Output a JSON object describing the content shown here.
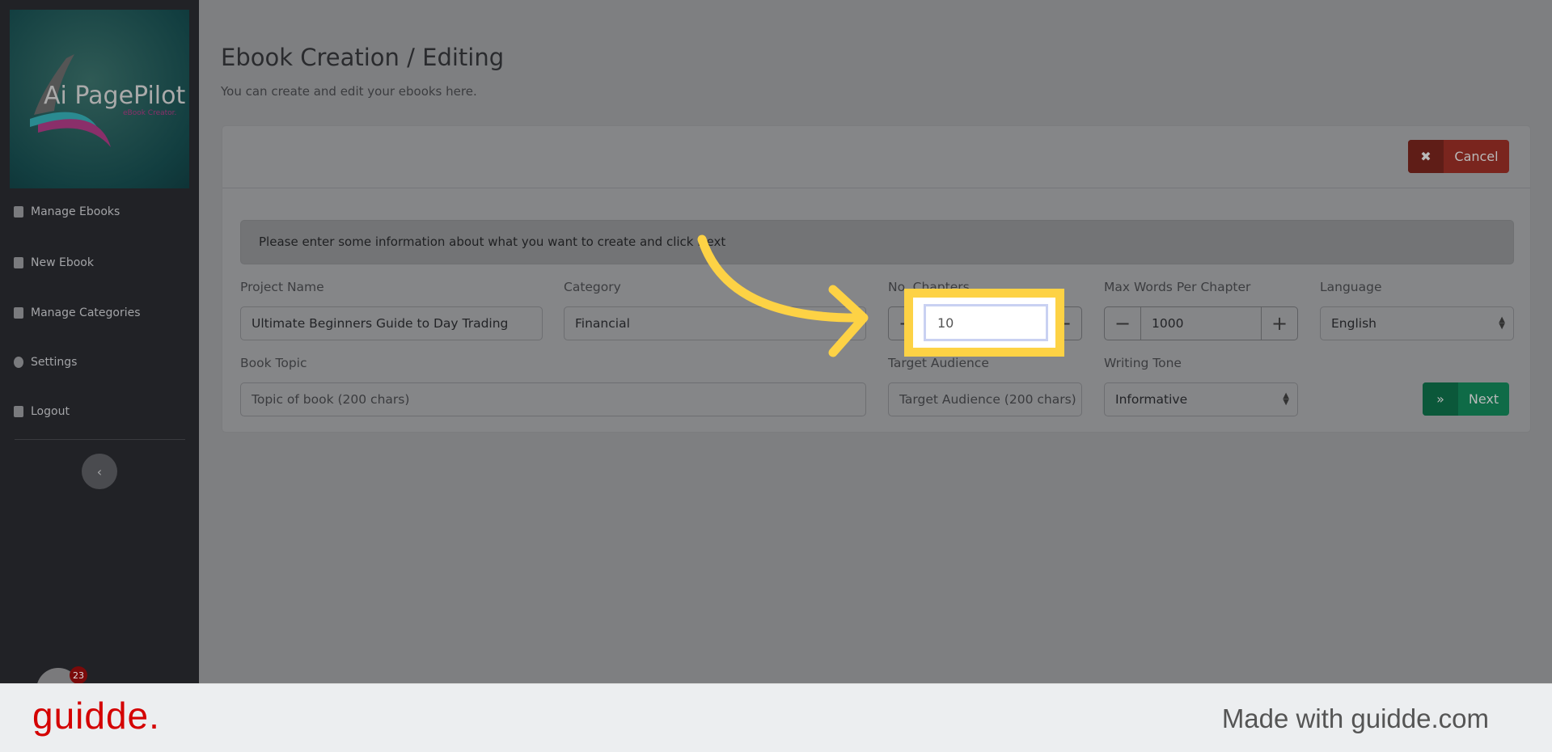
{
  "sidebar": {
    "logo_text": "Ai PagePilot",
    "logo_sub": "eBook Creator.",
    "items": [
      {
        "label": "Manage Ebooks",
        "icon": "clipboard-icon"
      },
      {
        "label": "New Ebook",
        "icon": "book-icon"
      },
      {
        "label": "Manage Categories",
        "icon": "folder-plus-icon"
      },
      {
        "label": "Settings",
        "icon": "gear-icon"
      },
      {
        "label": "Logout",
        "icon": "sign-out-icon"
      }
    ],
    "collapse_icon": "‹",
    "notification_count": "23"
  },
  "header": {
    "title": "Ebook Creation / Editing",
    "subtitle": "You can create and edit your ebooks here."
  },
  "card": {
    "cancel_label": "Cancel",
    "cancel_icon": "✖",
    "next_label": "Next",
    "next_icon": "»",
    "alert": "Please enter some information about what you want to create and click Next"
  },
  "form": {
    "project_name": {
      "label": "Project Name",
      "value": "Ultimate Beginners Guide to Day Trading"
    },
    "category": {
      "label": "Category",
      "value": "Financial"
    },
    "chapters": {
      "label": "No. Chapters",
      "value": "10"
    },
    "max_words": {
      "label": "Max Words Per Chapter",
      "value": "1000",
      "minus": "−",
      "plus": "+"
    },
    "language": {
      "label": "Language",
      "value": "English"
    },
    "book_topic": {
      "label": "Book Topic",
      "placeholder": "Topic of book (200 chars)"
    },
    "target_audience": {
      "label": "Target Audience",
      "placeholder": "Target Audience (200 chars)"
    },
    "writing_tone": {
      "label": "Writing Tone",
      "value": "Informative"
    }
  },
  "footer": {
    "brand": "guidde.",
    "tagline": "Made with guidde.com"
  },
  "colors": {
    "highlight": "#fdd245",
    "brand": "#d40000",
    "cancel": "#7a251e",
    "next": "#0f6b47"
  }
}
